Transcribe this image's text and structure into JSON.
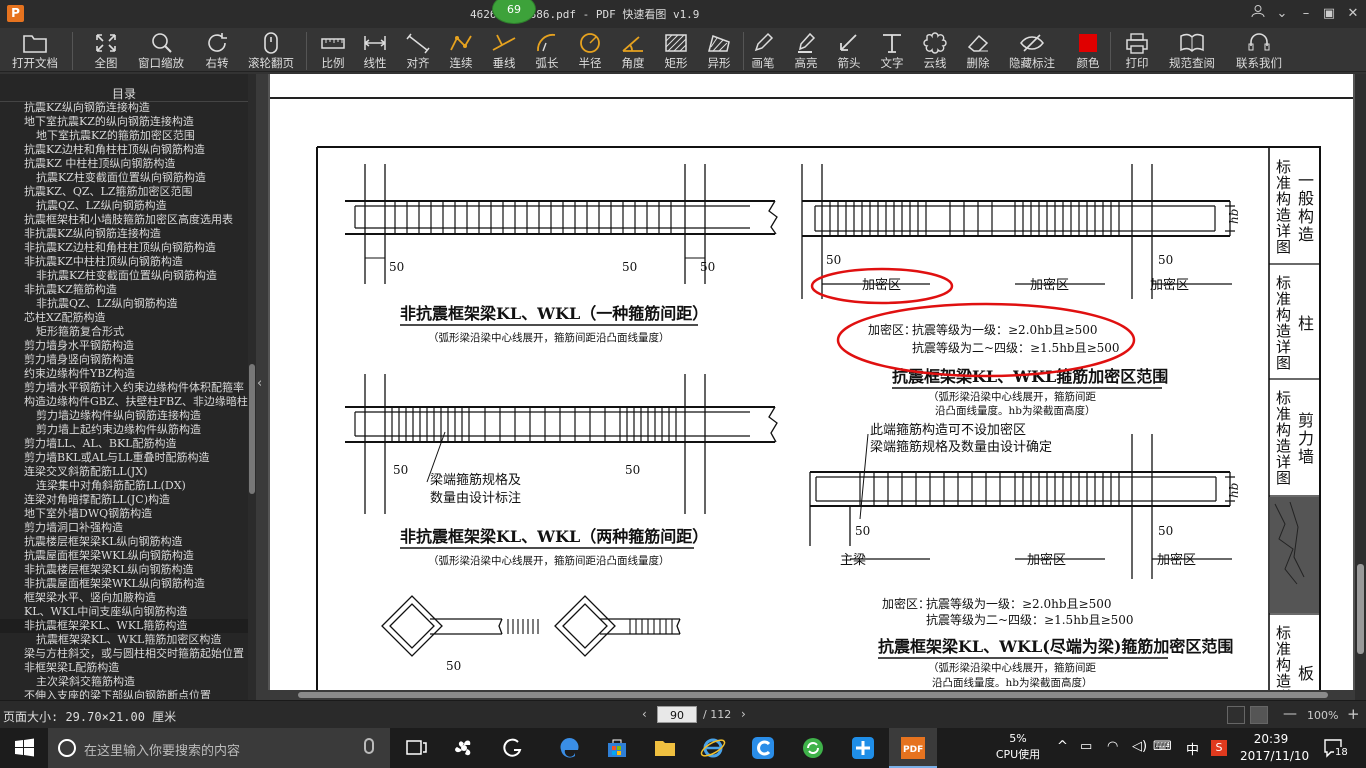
{
  "window": {
    "app_logo": "P",
    "title": "462609580886.pdf - PDF 快速看图 v1.9",
    "badge": "69"
  },
  "toolbar": {
    "tools": [
      {
        "id": "open",
        "label": "打开文档",
        "icon": "folder-icon"
      },
      {
        "id": "fit",
        "label": "全图",
        "icon": "expand-icon"
      },
      {
        "id": "window-zoom",
        "label": "窗口缩放",
        "icon": "magnifier-icon"
      },
      {
        "id": "rotate",
        "label": "右转",
        "icon": "rotate-icon"
      },
      {
        "id": "scroll-page",
        "label": "滚轮翻页",
        "icon": "mouse-icon"
      },
      {
        "id": "scale",
        "label": "比例",
        "icon": "ruler-icon"
      },
      {
        "id": "linear",
        "label": "线性",
        "icon": "linear-dim-icon"
      },
      {
        "id": "aligned",
        "label": "对齐",
        "icon": "aligned-dim-icon"
      },
      {
        "id": "continuous",
        "label": "连续",
        "icon": "continuous-dim-icon"
      },
      {
        "id": "perpendicular",
        "label": "垂线",
        "icon": "perpendicular-icon"
      },
      {
        "id": "arc",
        "label": "弧长",
        "icon": "arc-length-icon"
      },
      {
        "id": "radius",
        "label": "半径",
        "icon": "radius-icon"
      },
      {
        "id": "angle",
        "label": "角度",
        "icon": "angle-icon"
      },
      {
        "id": "rect",
        "label": "矩形",
        "icon": "rectangle-area-icon"
      },
      {
        "id": "irregular",
        "label": "异形",
        "icon": "irregular-area-icon"
      },
      {
        "id": "pen",
        "label": "画笔",
        "icon": "pen-icon"
      },
      {
        "id": "highlight",
        "label": "高亮",
        "icon": "highlighter-icon"
      },
      {
        "id": "arrow",
        "label": "箭头",
        "icon": "arrow-icon"
      },
      {
        "id": "text",
        "label": "文字",
        "icon": "text-icon"
      },
      {
        "id": "cloud",
        "label": "云线",
        "icon": "cloud-icon"
      },
      {
        "id": "delete",
        "label": "删除",
        "icon": "eraser-icon"
      },
      {
        "id": "hide",
        "label": "隐藏标注",
        "icon": "eye-hidden-icon"
      },
      {
        "id": "color",
        "label": "颜色",
        "icon": "color-swatch-icon"
      },
      {
        "id": "print",
        "label": "打印",
        "icon": "printer-icon"
      },
      {
        "id": "spec",
        "label": "规范查阅",
        "icon": "book-icon"
      },
      {
        "id": "contact",
        "label": "联系我们",
        "icon": "headset-icon"
      }
    ],
    "color_swatch": "#e00000"
  },
  "sidebar": {
    "title": "目录",
    "items": [
      {
        "text": "抗震KZ纵向钢筋连接构造",
        "level": 1
      },
      {
        "text": "地下室抗震KZ的纵向钢筋连接构造",
        "level": 1
      },
      {
        "text": "地下室抗震KZ的箍筋加密区范围",
        "level": 2
      },
      {
        "text": "抗震KZ边柱和角柱柱顶纵向钢筋构造",
        "level": 1
      },
      {
        "text": "抗震KZ 中柱柱顶纵向钢筋构造",
        "level": 1
      },
      {
        "text": "抗震KZ柱变截面位置纵向钢筋构造",
        "level": 2
      },
      {
        "text": "抗震KZ、QZ、LZ箍筋加密区范围",
        "level": 1
      },
      {
        "text": "抗震QZ、LZ纵向钢筋构造",
        "level": 2
      },
      {
        "text": "抗震框架柱和小墙肢箍筋加密区高度选用表",
        "level": 1
      },
      {
        "text": "非抗震KZ纵向钢筋连接构造",
        "level": 1
      },
      {
        "text": "非抗震KZ边柱和角柱柱顶纵向钢筋构造",
        "level": 1
      },
      {
        "text": "非抗震KZ中柱柱顶纵向钢筋构造",
        "level": 1
      },
      {
        "text": "非抗震KZ柱变截面位置纵向钢筋构造",
        "level": 2
      },
      {
        "text": "非抗震KZ箍筋构造",
        "level": 1
      },
      {
        "text": "非抗震QZ、LZ纵向钢筋构造",
        "level": 2
      },
      {
        "text": "芯柱XZ配筋构造",
        "level": 1
      },
      {
        "text": "矩形箍筋复合形式",
        "level": 2
      },
      {
        "text": "剪力墙身水平钢筋构造",
        "level": 1
      },
      {
        "text": "剪力墙身竖向钢筋构造",
        "level": 1
      },
      {
        "text": "约束边缘构件YBZ构造",
        "level": 1
      },
      {
        "text": "剪力墙水平钢筋计入约束边缘构件体积配箍率",
        "level": 1
      },
      {
        "text": "构造边缘构件GBZ、扶壁柱FBZ、非边缘暗柱",
        "level": 1
      },
      {
        "text": "剪力墙边缘构件纵向钢筋连接构造",
        "level": 2
      },
      {
        "text": "剪力墙上起约束边缘构件纵筋构造",
        "level": 2
      },
      {
        "text": "剪力墙LL、AL、BKL配筋构造",
        "level": 1
      },
      {
        "text": "剪力墙BKL或AL与LL重叠时配筋构造",
        "level": 1
      },
      {
        "text": "连梁交叉斜筋配筋LL(JX)",
        "level": 1
      },
      {
        "text": "连梁集中对角斜筋配筋LL(DX)",
        "level": 2
      },
      {
        "text": "连梁对角暗撑配筋LL(JC)构造",
        "level": 1
      },
      {
        "text": "地下室外墙DWQ钢筋构造",
        "level": 1
      },
      {
        "text": "剪力墙洞口补强构造",
        "level": 1
      },
      {
        "text": "抗震楼层框架梁KL纵向钢筋构造",
        "level": 1
      },
      {
        "text": "抗震屋面框架梁WKL纵向钢筋构造",
        "level": 1
      },
      {
        "text": "非抗震楼层框架梁KL纵向钢筋构造",
        "level": 1
      },
      {
        "text": "非抗震屋面框架梁WKL纵向钢筋构造",
        "level": 1
      },
      {
        "text": "框架梁水平、竖向加腋构造",
        "level": 1
      },
      {
        "text": "KL、WKL中间支座纵向钢筋构造",
        "level": 1
      },
      {
        "text": "非抗震框架梁KL、WKL箍筋构造",
        "level": 1,
        "selected": true
      },
      {
        "text": "抗震框架梁KL、WKL箍筋加密区构造",
        "level": 2
      },
      {
        "text": "梁与方柱斜交，或与圆柱相交时箍筋起始位置",
        "level": 1
      },
      {
        "text": "非框架梁L配筋构造",
        "level": 1
      },
      {
        "text": "主次梁斜交箍筋构造",
        "level": 2
      },
      {
        "text": "不伸入支座的梁下部纵向钢筋断点位置",
        "level": 1
      }
    ]
  },
  "drawing": {
    "side_tabs": [
      {
        "heading": "标准构造详图",
        "label": "一般构造"
      },
      {
        "heading": "标准构造详图",
        "label": "柱"
      },
      {
        "heading": "标准构造详图",
        "label": "剪力墙"
      },
      {
        "heading": "标准构造详图",
        "label": "板"
      }
    ],
    "fig1": {
      "title": "非抗震框架梁KL、WKL（一种箍筋间距）",
      "note": "（弧形梁沿梁中心线展开，箍筋间距沿凸面线量度）",
      "dims": [
        "50",
        "50",
        "50"
      ]
    },
    "fig2": {
      "title": "非抗震框架梁KL、WKL（两种箍筋间距）",
      "note": "（弧形梁沿梁中心线展开，箍筋间距沿凸面线量度）",
      "callout1": "梁端箍筋规格及",
      "callout2": "数量由设计标注",
      "dims": [
        "50",
        "50"
      ]
    },
    "fig3": {
      "title": "抗震框架梁KL、WKL箍筋加密区范围",
      "note1": "（弧形梁沿梁中心线展开，箍筋间距",
      "note2": "沿凸面线量度。hb为梁截面高度）",
      "zone": "加密区",
      "req_prefix": "加密区：",
      "req1": "抗震等级为一级：≥2.0hb且≥500",
      "req2": "抗震等级为二~四级：≥1.5hb且≥500",
      "height_label": "hb",
      "dims": [
        "50",
        "50"
      ]
    },
    "fig4": {
      "title": "抗震框架梁KL、WKL(尽端为梁)箍筋加密区范围",
      "note1": "（弧形梁沿梁中心线展开，箍筋间距",
      "note2": "沿凸面线量度。hb为梁截面高度）",
      "callout1": "此端箍筋构造可不设加密区",
      "callout2": "梁端箍筋规格及数量由设计确定",
      "main_beam": "主梁",
      "zone": "加密区",
      "req_prefix": "加密区：",
      "req1": "抗震等级为一级：≥2.0hb且≥500",
      "req2": "抗震等级为二~四级：≥1.5hb且≥500",
      "height_label": "hb",
      "dims": [
        "50",
        "50"
      ]
    },
    "fig5": {
      "dim": "50"
    },
    "annotation_color": "#e01010"
  },
  "statusbar": {
    "page_size": "页面大小: 29.70×21.00 厘米",
    "current_page": "90",
    "total_pages": "/ 112",
    "zoom": "100%"
  },
  "taskbar": {
    "search_placeholder": "在这里输入你要搜索的内容",
    "cpu_percent": "5%",
    "cpu_label": "CPU使用",
    "ime": "中",
    "time": "20:39",
    "date": "2017/11/10",
    "notifications": "18"
  }
}
